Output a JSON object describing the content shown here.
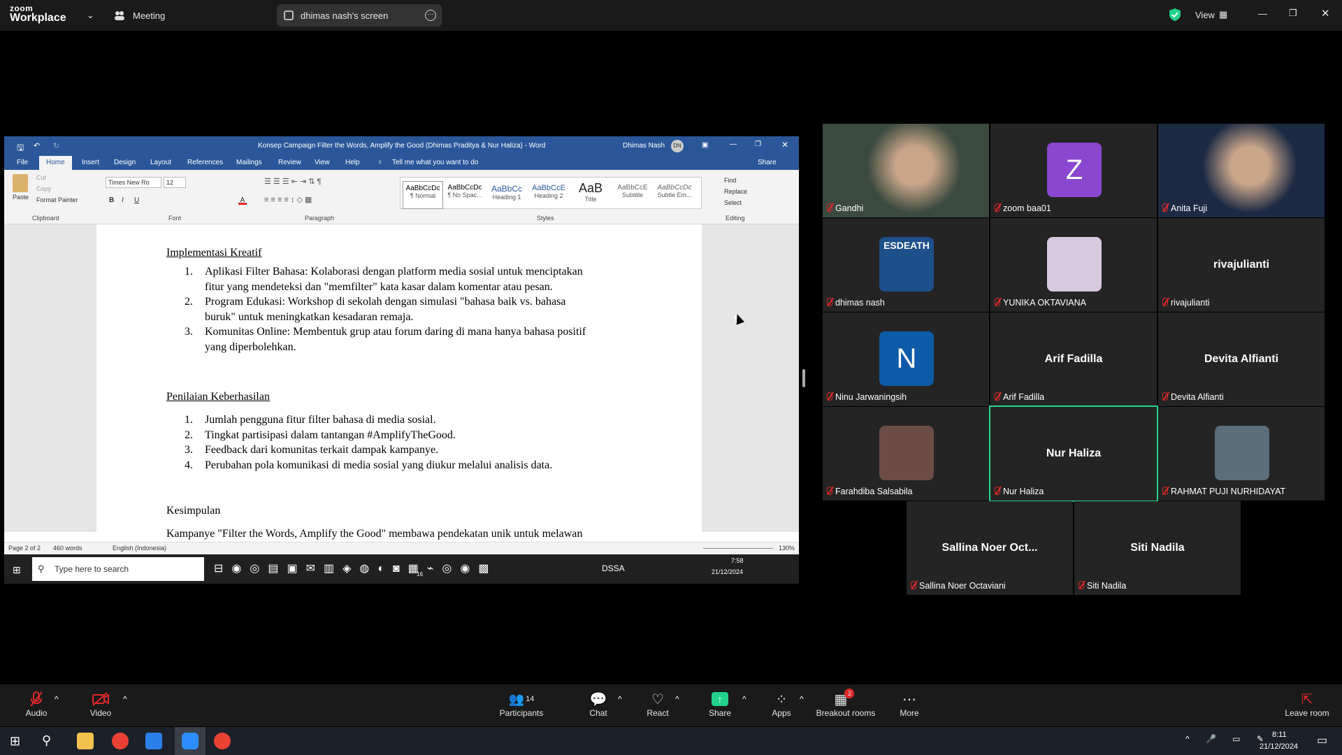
{
  "zoom": {
    "brand_top": "zoom",
    "brand_bottom": "Workplace",
    "meeting_label": "Meeting",
    "share_title": "dhimas nash's screen",
    "view_label": "View"
  },
  "word": {
    "window_title": "Konsep Campaign Filter the Words, Amplify the Good (Dhimas Praditya & Nur Haliza) - Word",
    "user_name": "Dhimas Nash",
    "user_initials": "DN",
    "tabs": [
      "File",
      "Home",
      "Insert",
      "Design",
      "Layout",
      "References",
      "Mailings",
      "Review",
      "View",
      "Help"
    ],
    "tell_me": "Tell me what you want to do",
    "share_btn": "Share",
    "clipboard": {
      "paste": "Paste",
      "cut": "Cut",
      "copy": "Copy",
      "format_painter": "Format Painter",
      "label": "Clipboard"
    },
    "font": {
      "name": "Times New Ro",
      "size": "12",
      "label": "Font"
    },
    "paragraph_label": "Paragraph",
    "styles": [
      {
        "preview": "AaBbCcDc",
        "name": "¶ Normal"
      },
      {
        "preview": "AaBbCcDc",
        "name": "¶ No Spac..."
      },
      {
        "preview": "AaBbCc",
        "name": "Heading 1"
      },
      {
        "preview": "AaBbCcE",
        "name": "Heading 2"
      },
      {
        "preview": "AaB",
        "name": "Title"
      },
      {
        "preview": "AaBbCcE",
        "name": "Subtitle"
      },
      {
        "preview": "AaBbCcDc",
        "name": "Subtle Em..."
      }
    ],
    "styles_label": "Styles",
    "editing": {
      "find": "Find",
      "replace": "Replace",
      "select": "Select",
      "label": "Editing"
    },
    "doc": {
      "h1": "Implementasi Kreatif",
      "items1": [
        {
          "n": "1.",
          "l1": "Aplikasi Filter Bahasa: Kolaborasi dengan platform media sosial untuk menciptakan",
          "l2": "fitur yang mendeteksi dan \"memfilter\" kata kasar dalam komentar atau pesan."
        },
        {
          "n": "2.",
          "l1": "Program Edukasi: Workshop di sekolah dengan simulasi \"bahasa baik vs. bahasa",
          "l2": "buruk\" untuk meningkatkan kesadaran remaja."
        },
        {
          "n": "3.",
          "l1": "Komunitas Online: Membentuk grup atau forum daring di mana hanya bahasa positif",
          "l2": "yang diperbolehkan."
        }
      ],
      "h2": "Penilaian Keberhasilan",
      "items2": [
        {
          "n": "1.",
          "t": "Jumlah pengguna fitur filter bahasa di media sosial."
        },
        {
          "n": "2.",
          "t": "Tingkat partisipasi dalam tantangan #AmplifyTheGood."
        },
        {
          "n": "3.",
          "t": "Feedback dari komunitas terkait dampak kampanye."
        },
        {
          "n": "4.",
          "t": "Perubahan pola komunikasi di media sosial yang diukur melalui analisis data."
        }
      ],
      "h3": "Kesimpulan",
      "last_line": "Kampanye \"Filter the Words, Amplify the Good\" membawa pendekatan unik untuk melawan"
    },
    "status": {
      "page": "Page 2 of 2",
      "words": "460 words",
      "lang": "English (Indonesia)",
      "zoom": "130%"
    },
    "inner_taskbar": {
      "search": "Type here to search",
      "dssa": "DSSA",
      "time": "7:58",
      "date": "21/12/2024",
      "badge": "16"
    }
  },
  "participants": [
    {
      "name": "Gandhi",
      "type": "video",
      "color": "#3a4a3e"
    },
    {
      "name": "zoom baa01",
      "type": "avatar",
      "letter": "Z",
      "color": "#8a47cf"
    },
    {
      "name": "Anita Fuji",
      "type": "video",
      "color": "#1c2a44"
    },
    {
      "name": "dhimas nash",
      "type": "image",
      "color": "#1d4f8a",
      "image_text": "ESDEATH"
    },
    {
      "name": "YUNIKA OKTAVIANA",
      "type": "image",
      "color": "#d9c9df"
    },
    {
      "name": "rivajulianti",
      "type": "text",
      "center": "rivajulianti"
    },
    {
      "name": "Ninu Jarwaningsih",
      "type": "avatar",
      "letter": "N",
      "color": "#0d5ba8"
    },
    {
      "name": "Arif Fadilla",
      "type": "text",
      "center": "Arif Fadilla"
    },
    {
      "name": "Devita Alfianti",
      "type": "text",
      "center": "Devita Alfianti"
    },
    {
      "name": "Farahdiba Salsabila",
      "type": "image",
      "color": "#6b4d45"
    },
    {
      "name": "Nur Haliza",
      "type": "text",
      "center": "Nur Haliza",
      "active": true
    },
    {
      "name": "RAHMAT PUJI NURHIDAYAT",
      "type": "image",
      "color": "#5a6e7c"
    },
    {
      "name": "Sallina Noer Octaviani",
      "type": "text",
      "center": "Sallina Noer Oct..."
    },
    {
      "name": "Siti Nadila",
      "type": "text",
      "center": "Siti Nadila"
    }
  ],
  "controls": {
    "audio": "Audio",
    "video": "Video",
    "participants": "Participants",
    "participants_count": "14",
    "chat": "Chat",
    "react": "React",
    "share": "Share",
    "apps": "Apps",
    "breakout": "Breakout rooms",
    "breakout_badge": "2",
    "more": "More",
    "leave": "Leave room"
  },
  "os": {
    "time": "8:11",
    "date": "21/12/2024"
  },
  "colors": {
    "active_speaker": "#23d18b",
    "zoom_share_green": "#23d18b",
    "word_blue": "#2b579a",
    "mute_red": "#e02828"
  }
}
